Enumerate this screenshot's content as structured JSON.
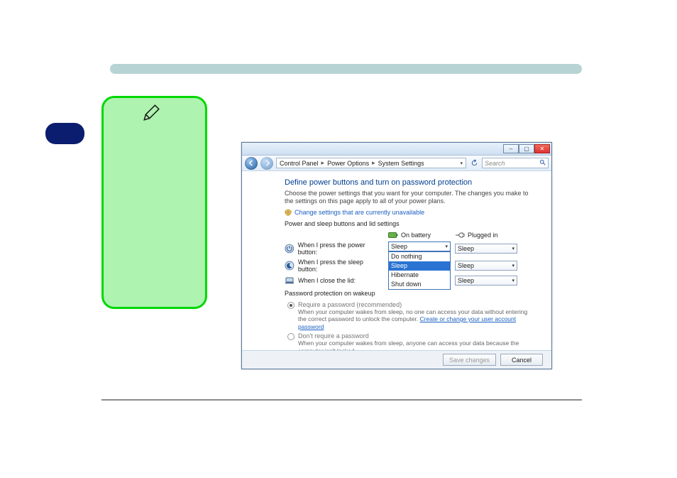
{
  "dialog": {
    "breadcrumb": {
      "a": "Control Panel",
      "b": "Power Options",
      "c": "System Settings"
    },
    "search_placeholder": "Search",
    "title": "Define power buttons and turn on password protection",
    "subtitle": "Choose the power settings that you want for your computer. The changes you make to the settings on this page apply to all of your power plans.",
    "change_link": "Change settings that are currently unavailable",
    "section1": "Power and sleep buttons and lid settings",
    "columns": {
      "battery": "On battery",
      "plugged": "Plugged in"
    },
    "rows": {
      "power": "When I press the power button:",
      "sleep": "When I press the sleep button:",
      "lid": "When I close the lid:"
    },
    "dropdown_value": "Sleep",
    "dropdown_options": [
      "Do nothing",
      "Sleep",
      "Hibernate",
      "Shut down"
    ],
    "section2": "Password protection on wakeup",
    "opt1": {
      "title": "Require a password (recommended)",
      "desc_a": "When your computer wakes from sleep, no one can access your data without entering the correct password to unlock the computer. ",
      "link": "Create or change your user account password"
    },
    "opt2": {
      "title": "Don't require a password",
      "desc": "When your computer wakes from sleep, anyone can access your data because the computer isn't locked."
    },
    "buttons": {
      "save": "Save changes",
      "cancel": "Cancel"
    }
  }
}
